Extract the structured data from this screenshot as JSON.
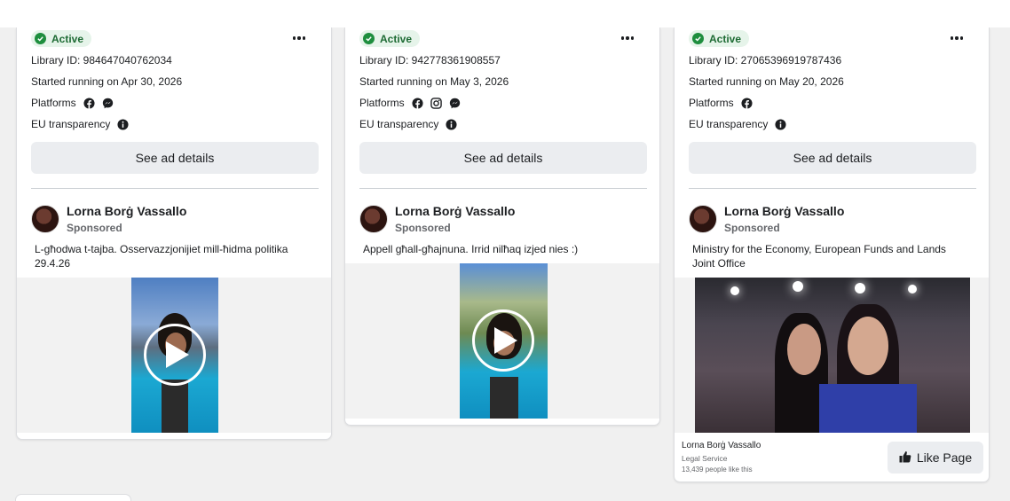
{
  "cards": [
    {
      "status": "Active",
      "library_id": "Library ID: 984647040762034",
      "started": "Started running on Apr 30, 2026",
      "platforms_label": "Platforms",
      "platform_icons": [
        "facebook-icon",
        "messenger-icon"
      ],
      "eu_label": "EU transparency",
      "details_label": "See ad details",
      "page_name": "Lorna Borġ Vassallo",
      "sponsored": "Sponsored",
      "caption": "L-għodwa t-tajba. Osservazzjonijiet mill-ħidma politika 29.4.26",
      "media_type": "video"
    },
    {
      "status": "Active",
      "library_id": "Library ID: 942778361908557",
      "started": "Started running on May 3, 2026",
      "platforms_label": "Platforms",
      "platform_icons": [
        "facebook-icon",
        "instagram-icon",
        "messenger-icon"
      ],
      "eu_label": "EU transparency",
      "details_label": "See ad details",
      "page_name": "Lorna Borġ Vassallo",
      "sponsored": "Sponsored",
      "caption": "Appell għall-għajnuna. Irrid nilħaq izjed nies :)",
      "media_type": "video"
    },
    {
      "status": "Active",
      "library_id": "Library ID: 27065396919787436",
      "started": "Started running on May 20, 2026",
      "platforms_label": "Platforms",
      "platform_icons": [
        "facebook-icon"
      ],
      "eu_label": "EU transparency",
      "details_label": "See ad details",
      "page_name": "Lorna Borġ Vassallo",
      "sponsored": "Sponsored",
      "caption": "Ministry for the Economy, European Funds and Lands Joint Office",
      "media_type": "image",
      "footer": {
        "page_name": "Lorna Borġ Vassallo",
        "category": "Legal Service",
        "likes": "13,439 people like this",
        "like_button": "Like Page"
      }
    }
  ],
  "colors": {
    "active_green": "#1e8e3e",
    "badge_bg": "#e6f4ea",
    "button_bg": "#ebedf0",
    "page_bg": "#f0f0f0"
  }
}
